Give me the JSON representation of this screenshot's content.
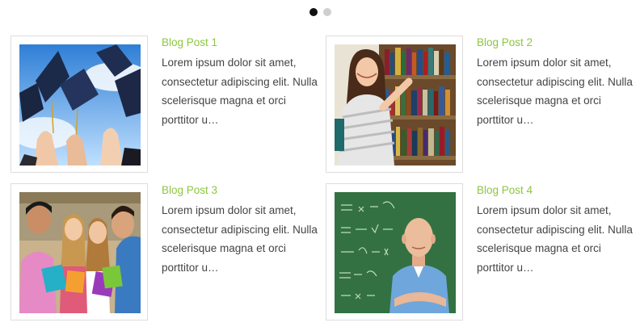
{
  "carousel": {
    "pages": 2,
    "active_page": 1
  },
  "posts": [
    {
      "title": "Blog Post 1",
      "excerpt": "Lorem ipsum dolor sit amet, consectetur adipiscing elit. Nulla scelerisque magna et orci porttitor u…",
      "image": "graduation-caps-photo"
    },
    {
      "title": "Blog Post 2",
      "excerpt": "Lorem ipsum dolor sit amet, consectetur adipiscing elit. Nulla scelerisque magna et orci porttitor u…",
      "image": "student-in-library-photo"
    },
    {
      "title": "Blog Post 3",
      "excerpt": "Lorem ipsum dolor sit amet, consectetur adipiscing elit. Nulla scelerisque magna et orci porttitor u…",
      "image": "group-of-students-photo"
    },
    {
      "title": "Blog Post 4",
      "excerpt": "Lorem ipsum dolor sit amet, consectetur adipiscing elit. Nulla scelerisque magna et orci porttitor u…",
      "image": "teacher-at-chalkboard-photo"
    }
  ],
  "colors": {
    "title_green": "#8cc63f",
    "body_text": "#444444",
    "thumb_border": "#dddddd"
  }
}
